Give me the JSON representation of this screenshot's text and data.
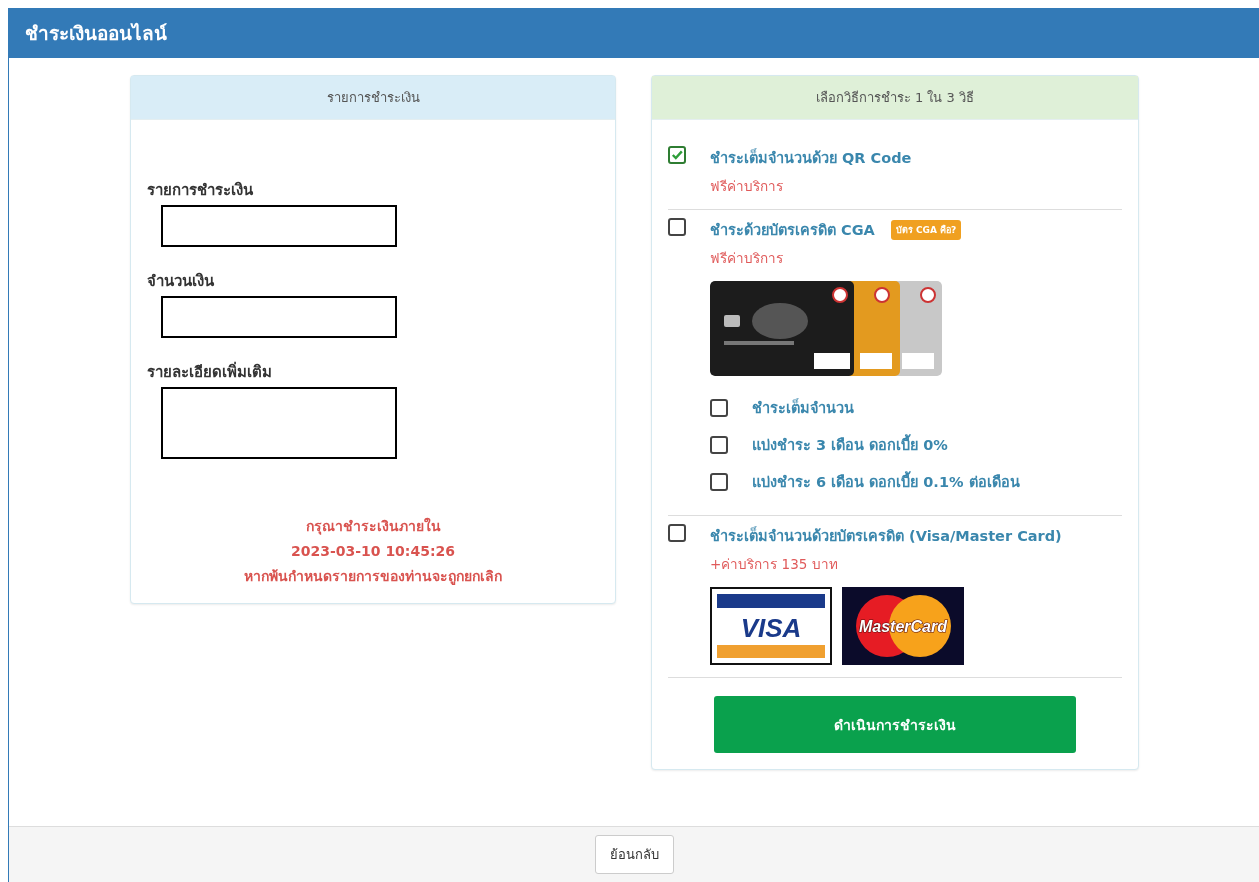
{
  "header": {
    "title": "ชำระเงินออนไลน์"
  },
  "summary": {
    "title": "รายการชำระเงิน",
    "fields": [
      {
        "label": "รายการชำระเงิน",
        "kind": "single"
      },
      {
        "label": "จำนวนเงิน",
        "kind": "single"
      },
      {
        "label": "รายละเอียดเพิ่มเติม",
        "kind": "multi"
      }
    ],
    "notice": [
      "กรุณาชำระเงินภายใน",
      "2023-03-10 10:45:26",
      "หากพ้นกำหนดรายการของท่านจะถูกยกเลิก"
    ]
  },
  "methods": {
    "title": "เลือกวิธีการชำระ 1 ใน 3 วิธี",
    "options": [
      {
        "label": "ชำระเต็มจำนวนด้วย QR Code",
        "fee": "ฟรีค่าบริการ",
        "checked": true
      },
      {
        "label": "ชำระด้วยบัตรเครดิต CGA",
        "badge": "บัตร CGA คือ?",
        "fee": "ฟรีค่าบริการ",
        "checked": false,
        "sub_options": [
          {
            "label": "ชำระเต็มจำนวน",
            "checked": false
          },
          {
            "label": "แบ่งชำระ 3 เดือน ดอกเบี้ย 0%",
            "checked": false
          },
          {
            "label": "แบ่งชำระ 6 เดือน ดอกเบี้ย 0.1% ต่อเดือน",
            "checked": false
          }
        ]
      },
      {
        "label": "ชำระเต็มจำนวนด้วยบัตรเครดิต (Visa/Master Card)",
        "fee": "+ค่าบริการ 135 บาท",
        "checked": false,
        "logos": [
          {
            "kind": "visa",
            "text": "VISA"
          },
          {
            "kind": "mastercard",
            "text": "MasterCard"
          }
        ]
      }
    ],
    "submit": "ดำเนินการชำระเงิน"
  },
  "footer": {
    "back": "ย้อนกลับ"
  }
}
